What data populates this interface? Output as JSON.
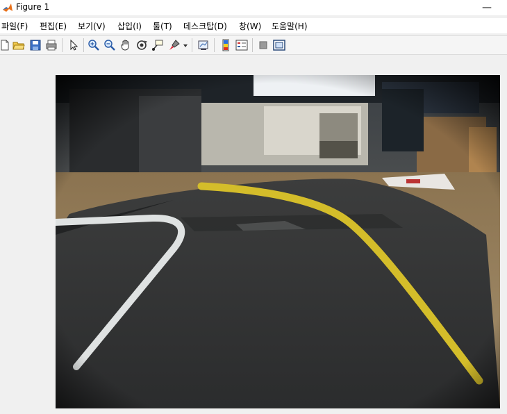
{
  "window": {
    "title": "Figure 1",
    "minimize_glyph": "—"
  },
  "menu": [
    {
      "label": "파일(F)"
    },
    {
      "label": "편집(E)"
    },
    {
      "label": "보기(V)"
    },
    {
      "label": "삽입(I)"
    },
    {
      "label": "툴(T)"
    },
    {
      "label": "데스크탑(D)"
    },
    {
      "label": "창(W)"
    },
    {
      "label": "도움말(H)"
    }
  ],
  "toolbar_icons": [
    "new-figure-icon",
    "open-file-icon",
    "save-icon",
    "print-icon",
    "select-arrow-icon",
    "zoom-in-icon",
    "zoom-out-icon",
    "pan-hand-icon",
    "rotate-3d-icon",
    "data-cursor-icon",
    "brush-icon",
    "link-plot-icon",
    "colorbar-icon",
    "legend-icon",
    "hide-plot-tools-icon",
    "show-plot-tools-icon"
  ],
  "figure_image": {
    "alt": "Fisheye camera view of a dark track mat with a yellow and a white lane line in a lab room"
  }
}
